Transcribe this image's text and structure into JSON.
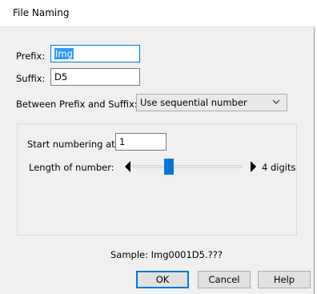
{
  "dialog": {
    "title": "File Naming",
    "prefix": {
      "label": "Prefix:",
      "value": "Img"
    },
    "suffix": {
      "label": "Suffix:",
      "value": "D5"
    },
    "between": {
      "label": "Between Prefix and Suffix:",
      "selected": "Use sequential number"
    },
    "numbering": {
      "start_label": "Start numbering at:",
      "start_value": "1",
      "length_label": "Length of number:",
      "length_value": "4 digits"
    },
    "sample": "Sample: Img0001D5.???",
    "buttons": {
      "ok": "OK",
      "cancel": "Cancel",
      "help": "Help"
    }
  },
  "colors": {
    "accent": "#0078d7",
    "selection": "#3399ff"
  },
  "icons": [
    "chevron-down-icon",
    "decrease-arrow-icon",
    "increase-arrow-icon"
  ]
}
